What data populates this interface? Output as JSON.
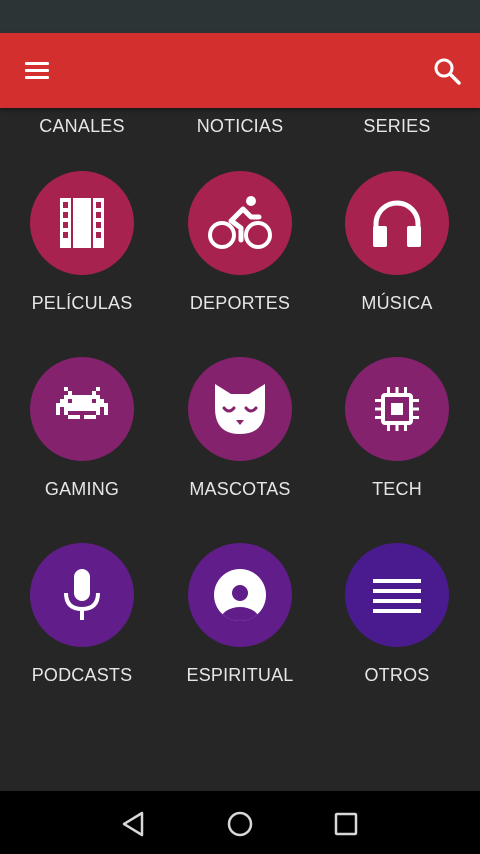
{
  "colors": {
    "app_bar": "#d32f2f",
    "background": "#262626",
    "row1": "#a7224f",
    "row2": "#85226e",
    "row3": "#611e8a",
    "otros": "#4a1a8f"
  },
  "header": {
    "menu_icon": "hamburger-menu-icon",
    "search_icon": "search-icon"
  },
  "top_row": [
    "CANALES",
    "NOTICIAS",
    "SERIES"
  ],
  "categories": [
    {
      "label": "PELÍCULAS",
      "icon": "film-icon"
    },
    {
      "label": "DEPORTES",
      "icon": "cyclist-icon"
    },
    {
      "label": "MÚSICA",
      "icon": "headphones-icon"
    },
    {
      "label": "GAMING",
      "icon": "space-invader-icon"
    },
    {
      "label": "MASCOTAS",
      "icon": "cat-face-icon"
    },
    {
      "label": "TECH",
      "icon": "chip-icon"
    },
    {
      "label": "PODCASTS",
      "icon": "microphone-icon"
    },
    {
      "label": "ESPIRITUAL",
      "icon": "person-circle-icon"
    },
    {
      "label": "OTROS",
      "icon": "list-icon"
    }
  ],
  "nav": {
    "back_icon": "back-triangle-icon",
    "home_icon": "home-circle-icon",
    "recents_icon": "recents-square-icon"
  }
}
